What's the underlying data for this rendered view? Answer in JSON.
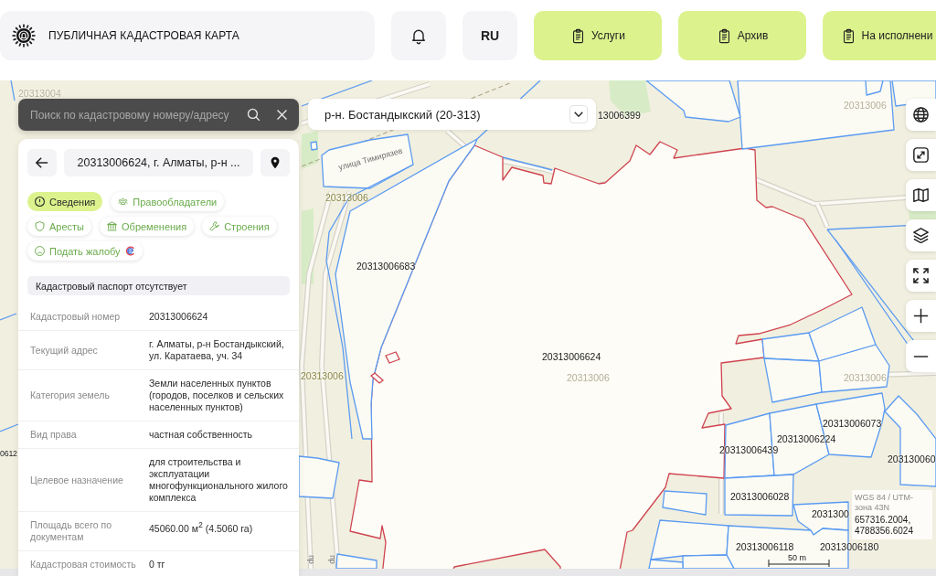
{
  "header": {
    "title": "ПУБЛИЧНАЯ КАДАСТРОВАЯ КАРТА",
    "language": "RU",
    "nav_buttons": [
      {
        "label": "Услуги"
      },
      {
        "label": "Архив"
      },
      {
        "label": "На исполнени"
      }
    ]
  },
  "search": {
    "placeholder": "Поиск по кадастровому номеру/адресу"
  },
  "district_select": {
    "value": "р-н. Бостандыкский (20-313)"
  },
  "parcel_panel": {
    "title": "20313006624, г. Алматы, р-н ...",
    "tabs": [
      {
        "label": "Сведения",
        "selected": true
      },
      {
        "label": "Правообладатели",
        "selected": false
      },
      {
        "label": "Аресты",
        "selected": false
      },
      {
        "label": "Обременения",
        "selected": false
      },
      {
        "label": "Строения",
        "selected": false
      },
      {
        "label": "Подать жалобу",
        "selected": false
      }
    ],
    "notice": "Кадастровый паспорт отсутствует",
    "rows": [
      {
        "label": "Кадастровый номер",
        "value": "20313006624"
      },
      {
        "label": "Текущий адрес",
        "value": "г. Алматы, р-н Бостандыкский, ул. Каратаева, уч. 34"
      },
      {
        "label": "Категория земель",
        "value": "Земли населенных пунктов (городов, поселков и сельских населенных пунктов)"
      },
      {
        "label": "Вид права",
        "value": "частная собственность"
      },
      {
        "label": "Целевое назначение",
        "value": "для строительства и эксплуатации многофункционального жилого комплекса"
      },
      {
        "label": "Площадь всего по документам",
        "value": "45060.00 м$^{2}$ (4.5060 га)"
      },
      {
        "label": "Кадастровая стоимость",
        "value": "0 тг"
      }
    ]
  },
  "map": {
    "labels": [
      {
        "text": "20313004",
        "kind": "quarter_faint"
      },
      {
        "text": "13006399",
        "kind": "parcel"
      },
      {
        "text": "улица Тимирязев",
        "kind": "street"
      },
      {
        "text": "20313006",
        "kind": "quarter"
      },
      {
        "text": "20313006683",
        "kind": "parcel"
      },
      {
        "text": "20313006",
        "kind": "quarter"
      },
      {
        "text": "20313006624",
        "kind": "parcel"
      },
      {
        "text": "20313006",
        "kind": "quarter_faint"
      },
      {
        "text": "20313006",
        "kind": "quarter_faint"
      },
      {
        "text": "20313006",
        "kind": "quarter_faint"
      },
      {
        "text": "20313006073",
        "kind": "parcel"
      },
      {
        "text": "20313006224",
        "kind": "parcel"
      },
      {
        "text": "20313006439",
        "kind": "parcel"
      },
      {
        "text": "203130060",
        "kind": "parcel"
      },
      {
        "text": "20313006028",
        "kind": "parcel"
      },
      {
        "text": "2031300",
        "kind": "parcel"
      },
      {
        "text": "20313006118",
        "kind": "parcel"
      },
      {
        "text": "20313006180",
        "kind": "parcel"
      },
      {
        "text": "0612",
        "kind": "parcel"
      },
      {
        "text": "пр",
        "kind": "street"
      },
      {
        "text": "пр",
        "kind": "street"
      }
    ],
    "coordinates": {
      "system": "WGS 84 / UTM-зона 43N",
      "value": "657316.2004, 4788356.6024"
    },
    "scale": "50 m"
  }
}
